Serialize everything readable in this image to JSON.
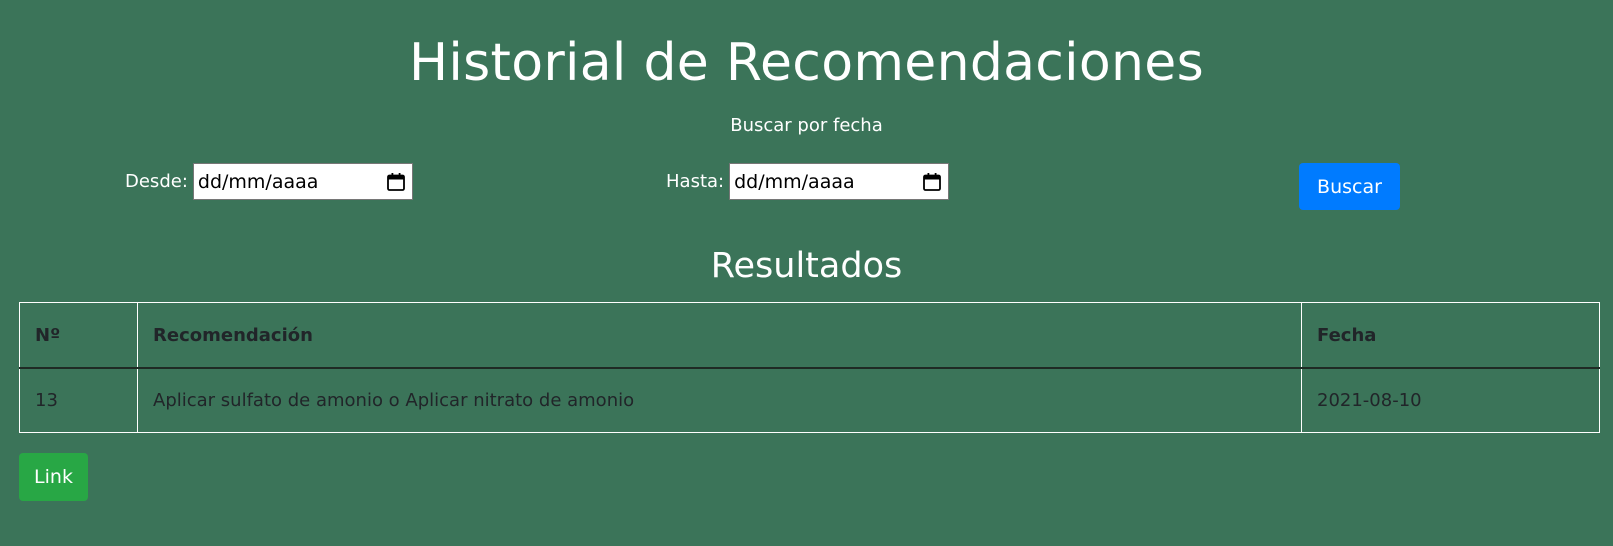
{
  "header": {
    "title": "Historial de Recomendaciones",
    "search_heading": "Buscar por fecha"
  },
  "filters": {
    "desde_label": "Desde:",
    "desde_value": "dd/mm/aaaa",
    "hasta_label": "Hasta:",
    "hasta_value": "dd/mm/aaaa",
    "buscar_label": "Buscar"
  },
  "results": {
    "heading": "Resultados",
    "columns": [
      "Nº",
      "Recomendación",
      "Fecha"
    ],
    "rows": [
      [
        "13",
        "Aplicar sulfato de amonio o Aplicar nitrato de amonio",
        "2021-08-10"
      ]
    ]
  },
  "footer": {
    "link_label": "Link"
  },
  "colors": {
    "background": "#3b7459",
    "primary_button": "#007bff",
    "success_button": "#28a745"
  },
  "icons": {
    "date_picker": "calendar-icon"
  }
}
